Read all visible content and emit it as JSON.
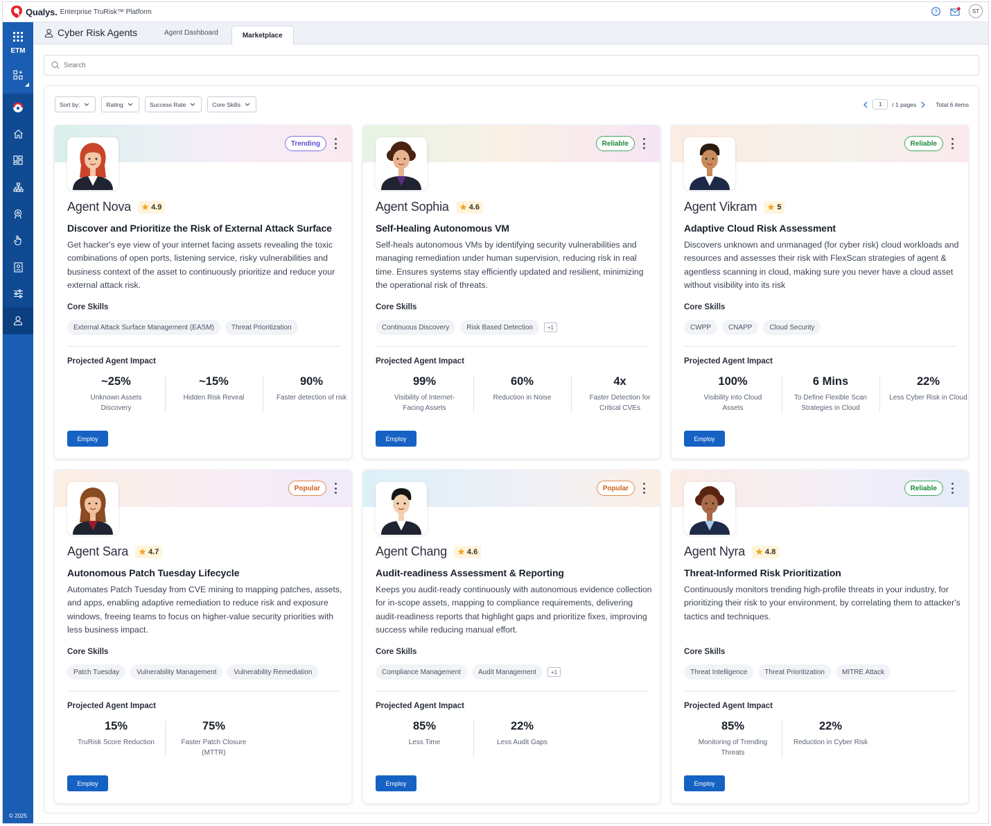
{
  "app": {
    "brand": "Qualys.",
    "platform": "Enterprise TruRisk™ Platform",
    "user_initials": "ST",
    "copyright": "© 2025",
    "colors": {
      "primary": "#1661c4",
      "sidebar": "#1a5db3"
    }
  },
  "sidebar": {
    "top_label": "ETM"
  },
  "header": {
    "title": "Cyber Risk Agents",
    "tabs": [
      {
        "label": "Agent Dashboard"
      },
      {
        "label": "Marketplace"
      }
    ]
  },
  "search": {
    "placeholder": "Search"
  },
  "filters": [
    {
      "label": "Sort by:"
    },
    {
      "label": "Rating"
    },
    {
      "label": "Success Rate"
    },
    {
      "label": "Core Skills"
    }
  ],
  "pagination": {
    "page": "1",
    "pages_text": "/ 1 pages",
    "total_text": "Total 6 items"
  },
  "cards": [
    {
      "name": "Agent Nova",
      "rating": "4.9",
      "badge": "Trending",
      "title": "Discover and Prioritize the Risk of External Attack Surface",
      "description": "Get hacker's eye view of your internet facing assets revealing the toxic combinations of open ports, listening service, risky vulnerabilities and business context of the asset to continuously prioritize and reduce your external attack risk.",
      "core_skills_label": "Core Skills",
      "skills": [
        "External Attack Surface Management (EASM)",
        "Threat Prioritization"
      ],
      "more": "",
      "impact_label": "Projected Agent Impact",
      "impacts": [
        {
          "value": "~25%",
          "desc": "Unknown Assets Discovery"
        },
        {
          "value": "~15%",
          "desc": "Hidden Risk Reveal"
        },
        {
          "value": "90%",
          "desc": "Faster detection of risk"
        }
      ],
      "employ": "Employ"
    },
    {
      "name": "Agent Sophia",
      "rating": "4.6",
      "badge": "Reliable",
      "title": "Self-Healing Autonomous VM",
      "description": "Self-heals autonomous VMs by identifying security vulnerabilities and managing remediation under human supervision, reducing risk in real time. Ensures systems stay efficiently updated and resilient, minimizing the operational risk of threats.",
      "core_skills_label": "Core Skills",
      "skills": [
        "Continuous Discovery",
        "Risk Based Detection"
      ],
      "more": "+1",
      "impact_label": "Projected Agent Impact",
      "impacts": [
        {
          "value": "99%",
          "desc": "Visibility of Internet-Facing Assets"
        },
        {
          "value": "60%",
          "desc": "Reduction in Noise"
        },
        {
          "value": "4x",
          "desc": "Faster Detection for Critical CVEs"
        }
      ],
      "employ": "Employ"
    },
    {
      "name": "Agent Vikram",
      "rating": "5",
      "badge": "Reliable",
      "title": "Adaptive Cloud Risk Assessment",
      "description": "Discovers unknown and unmanaged (for cyber risk) cloud workloads and resources and assesses their risk with FlexScan strategies of agent & agentless scanning in cloud, making sure you never have a cloud asset without visibility into its risk",
      "core_skills_label": "Core Skills",
      "skills": [
        "CWPP",
        "CNAPP",
        "Cloud Security"
      ],
      "more": "",
      "impact_label": "Projected Agent Impact",
      "impacts": [
        {
          "value": "100%",
          "desc": "Visibility into Cloud Assets"
        },
        {
          "value": "6 Mins",
          "desc": "To Define Flexible Scan Strategies in Cloud"
        },
        {
          "value": "22%",
          "desc": "Less Cyber Risk in Cloud"
        }
      ],
      "employ": "Employ"
    },
    {
      "name": "Agent Sara",
      "rating": "4.7",
      "badge": "Popular",
      "title": "Autonomous Patch Tuesday Lifecycle",
      "description": "Automates Patch Tuesday from CVE mining to mapping patches, assets, and apps, enabling adaptive remediation to reduce risk and exposure windows, freeing teams to focus on higher-value security priorities with less business impact.",
      "core_skills_label": "Core Skills",
      "skills": [
        "Patch Tuesday",
        "Vulnerability Management",
        "Vulnerability Remediation"
      ],
      "more": "",
      "impact_label": "Projected Agent Impact",
      "impacts": [
        {
          "value": "15%",
          "desc": "TruRisk Score Reduction"
        },
        {
          "value": "75%",
          "desc": "Faster Patch Closure (MTTR)"
        }
      ],
      "employ": "Employ"
    },
    {
      "name": "Agent Chang",
      "rating": "4.6",
      "badge": "Popular",
      "title": "Audit-readiness Assessment & Reporting",
      "description": "Keeps you audit-ready continuously with autonomous evidence collection for in-scope assets, mapping to compliance requirements, delivering audit-readiness reports that highlight gaps and prioritize fixes, improving success while reducing manual effort.",
      "core_skills_label": "Core Skills",
      "skills": [
        "Compliance Management",
        "Audit Management"
      ],
      "more": "+1",
      "impact_label": "Projected Agent Impact",
      "impacts": [
        {
          "value": "85%",
          "desc": "Less Time"
        },
        {
          "value": "22%",
          "desc": "Less Audit Gaps"
        }
      ],
      "employ": "Employ"
    },
    {
      "name": "Agent Nyra",
      "rating": "4.8",
      "badge": "Reliable",
      "title": "Threat-Informed Risk Prioritization",
      "description": "Continuously monitors trending high-profile threats in your industry, for prioritizing their risk to your environment, by correlating them to attacker's tactics and techniques.",
      "core_skills_label": "Core Skills",
      "skills": [
        "Threat Intelligence",
        "Threat Prioritization",
        "MITRE Attack"
      ],
      "more": "",
      "impact_label": "Projected Agent Impact",
      "impacts": [
        {
          "value": "85%",
          "desc": "Monitoring of Trending Threats"
        },
        {
          "value": "22%",
          "desc": "Reduction in Cyber Risk"
        }
      ],
      "employ": "Employ"
    }
  ]
}
